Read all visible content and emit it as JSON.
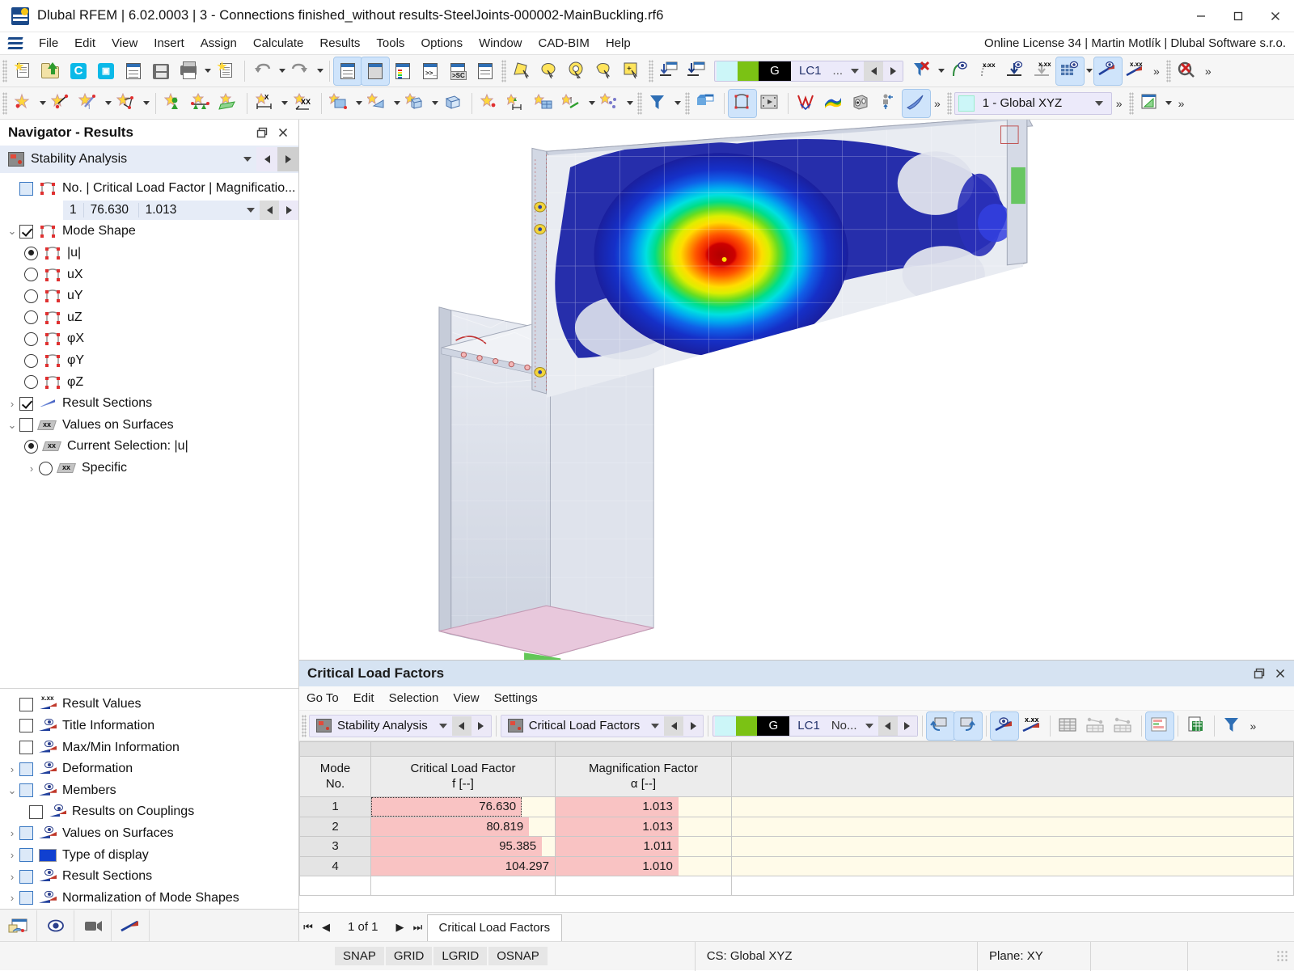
{
  "window": {
    "title": "Dlubal RFEM | 6.02.0003 | 3 - Connections finished_without results-SteelJoints-000002-MainBuckling.rf6",
    "minimize": "─",
    "maximize": "□",
    "close": "✕"
  },
  "menu": {
    "items": [
      "File",
      "Edit",
      "View",
      "Insert",
      "Assign",
      "Calculate",
      "Results",
      "Tools",
      "Options",
      "Window",
      "CAD-BIM",
      "Help"
    ],
    "license": "Online License 34 | Martin Motlík | Dlubal Software s.r.o."
  },
  "toolbar1": {
    "load_case_label": "LC1",
    "load_case_g": "G",
    "more_label": "...",
    "overflow": "»"
  },
  "toolbar2": {
    "coordinate_system": "1 - Global XYZ",
    "overflow": "»"
  },
  "navigator": {
    "title": "Navigator - Results",
    "analysis_combo": "Stability Analysis",
    "mode_header": "No. | Critical Load Factor | Magnificatio...",
    "mode_row": {
      "no": "1",
      "critical_load_factor": "76.630",
      "magnification_factor": "1.013"
    },
    "mode_shape_label": "Mode Shape",
    "components": [
      {
        "label": "|u|",
        "selected": true
      },
      {
        "label": "uX",
        "selected": false
      },
      {
        "label": "uY",
        "selected": false
      },
      {
        "label": "uZ",
        "selected": false
      },
      {
        "label": "φX",
        "selected": false
      },
      {
        "label": "φY",
        "selected": false
      },
      {
        "label": "φZ",
        "selected": false
      }
    ],
    "result_sections_label": "Result Sections",
    "values_on_surfaces_label": "Values on Surfaces",
    "current_selection_label": "Current Selection: |u|",
    "specific_label": "Specific",
    "display_options": [
      {
        "label": "Result Values",
        "icon": "xxx-result-icon",
        "checkbox": "empty",
        "expander": false
      },
      {
        "label": "Title Information",
        "icon": "eye-result-icon",
        "checkbox": "empty",
        "expander": false
      },
      {
        "label": "Max/Min Information",
        "icon": "eye-result-icon",
        "checkbox": "empty",
        "expander": false
      },
      {
        "label": "Deformation",
        "icon": "eye-result-icon",
        "checkbox": "blue",
        "expander": "collapsed"
      },
      {
        "label": "Members",
        "icon": "eye-result-icon",
        "checkbox": "blue",
        "expander": "expanded"
      },
      {
        "label": "Results on Couplings",
        "icon": "eye-result-icon",
        "checkbox": "empty",
        "expander": false,
        "indent": true
      },
      {
        "label": "Values on Surfaces",
        "icon": "eye-result-icon",
        "checkbox": "blue",
        "expander": "collapsed"
      },
      {
        "label": "Type of display",
        "icon": "rainbow-icon",
        "checkbox": "blue",
        "expander": "collapsed"
      },
      {
        "label": "Result Sections",
        "icon": "eye-result-icon",
        "checkbox": "blue",
        "expander": "collapsed"
      },
      {
        "label": "Normalization of Mode Shapes",
        "icon": "eye-result-icon",
        "checkbox": "blue",
        "expander": "collapsed"
      }
    ]
  },
  "table_panel": {
    "title": "Critical Load Factors",
    "menu": [
      "Go To",
      "Edit",
      "Selection",
      "View",
      "Settings"
    ],
    "combo_analysis": "Stability Analysis",
    "combo_table": "Critical Load Factors",
    "load_case_g": "G",
    "load_case_label": "LC1",
    "no_label": "No...",
    "columns": [
      {
        "title": "Mode",
        "sub": "No."
      },
      {
        "title": "Critical Load Factor",
        "sub": "f [--]"
      },
      {
        "title": "Magnification Factor",
        "sub": "α [--]"
      },
      {
        "title": "",
        "sub": ""
      }
    ],
    "rows": [
      {
        "no": "1",
        "critical_load_factor": "76.630",
        "magnification_factor": "1.013",
        "selected": true,
        "clf_bar": 82,
        "mag_bar": 70
      },
      {
        "no": "2",
        "critical_load_factor": "80.819",
        "magnification_factor": "1.013",
        "selected": false,
        "clf_bar": 86,
        "mag_bar": 70
      },
      {
        "no": "3",
        "critical_load_factor": "95.385",
        "magnification_factor": "1.011",
        "selected": false,
        "clf_bar": 93,
        "mag_bar": 70
      },
      {
        "no": "4",
        "critical_load_factor": "104.297",
        "magnification_factor": "1.010",
        "selected": false,
        "clf_bar": 100,
        "mag_bar": 70
      }
    ],
    "pagination": "1 of 1",
    "active_tab": "Critical Load Factors",
    "first_icon": "⏮",
    "prev_icon": "◀",
    "next_icon": "▶",
    "last_icon": "⏭"
  },
  "statusbar": {
    "buttons": [
      "SNAP",
      "GRID",
      "LGRID",
      "OSNAP"
    ],
    "coordinate_system": "CS: Global XYZ",
    "plane": "Plane: XY"
  },
  "colors": {
    "accent": "#d6e3f2",
    "bar_red": "#f9c3c3",
    "cell_bg": "#fffbe9",
    "combo_bg": "#eceafa",
    "nav_combo_bg": "#e6ecf7",
    "contour_red": "#cc0000",
    "contour_orange": "#ff8800",
    "contour_yellow": "#ffee00",
    "contour_green": "#22cc33",
    "contour_cyan": "#00e0e8",
    "contour_blue": "#1030c8",
    "contour_darkblue": "#1a1aa8",
    "model_grey": "#d9dde6",
    "baseplate_pink": "#e8c8dc",
    "baseplate_green": "#55c24a",
    "toolbar_green": "#7bc214",
    "toolbar_cyan": "#ccf6f8"
  }
}
